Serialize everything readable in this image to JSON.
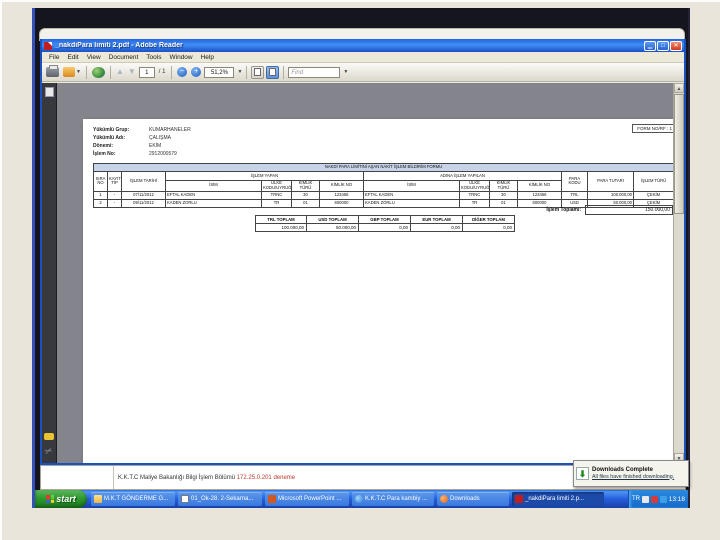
{
  "reader": {
    "title": "_nakdiPara limiti 2.pdf - Adobe Reader",
    "menus": [
      "File",
      "Edit",
      "View",
      "Document",
      "Tools",
      "Window",
      "Help"
    ],
    "toolbar": {
      "page_current": "1",
      "page_total": "/ 1",
      "zoom_out": "−",
      "zoom_in": "+",
      "zoom_level": "51,2%",
      "find_placeholder": "Find",
      "prev_glyph": "▲",
      "next_glyph": "▼"
    },
    "winbtns": {
      "minimize": "▁",
      "maximize": "□",
      "close": "✕"
    },
    "scrollbar": {
      "up": "▲",
      "down": "▼"
    }
  },
  "doc": {
    "form_no": "FORM NO/RF : 1",
    "meta": [
      {
        "label": "Yükümlü Grup:",
        "value": "KUMARHANELER"
      },
      {
        "label": "Yükümlü Adı:",
        "value": "ÇALIŞMA"
      },
      {
        "label": "Dönemi:",
        "value": "EKİM"
      },
      {
        "label": "İşlem No:",
        "value": "2912000579"
      }
    ],
    "table": {
      "title": "NAKDİ PARA LİMİTİNİ AŞAN NAKİT İŞLEM BİLDİRİM FORMU",
      "headers": {
        "sira_no": "SIRA NO",
        "kayit_tip": "KAYIT TİP",
        "islem_tarihi": "İŞLEM TARİHİ",
        "group1": "İŞLEM YAPAN",
        "group2": "ADINA İŞLEM YAPILAN",
        "isim": "İSİM",
        "ulke": "ÜLKE KODU/UYRUĞU",
        "kimlik_turu": "KİMLİK TÜRÜ",
        "kimlik_no": "KİMLİK NO",
        "para_kodu": "PARA KODU",
        "para_tutari": "PARA TUTARI",
        "islem_turu": "İŞLEM TÜRÜ"
      },
      "rows": [
        [
          "1",
          "-",
          "07/11/2012",
          "EFTAL KADEN",
          "TRNC",
          "30",
          "123456",
          "EFTAL KADEN",
          "TRNC",
          "30",
          "123456",
          "TRL",
          "100.000,00",
          "ÇEKİM"
        ],
        [
          "2",
          "-",
          "09/11/2012",
          "KADEN ZORLU",
          "TR",
          "01",
          "600000",
          "KADEN ZORLU",
          "TR",
          "01",
          "600000",
          "USD",
          "50.000,00",
          "ÇEKİM"
        ]
      ],
      "total_label": "İşlem Toplamı:",
      "total_value": "150.000,00"
    },
    "totals": [
      {
        "label": "TRL TOPLAM",
        "value": "100.000,00"
      },
      {
        "label": "USD TOPLAM",
        "value": "50.000,00"
      },
      {
        "label": "GBP TOPLAM",
        "value": "0,00"
      },
      {
        "label": "EUR TOPLAM",
        "value": "0,00"
      },
      {
        "label": "DİĞER TOPLAM",
        "value": "0,00"
      }
    ]
  },
  "statusbar": {
    "text": "K.K.T.C Maliye Bakanlığı Bilgi İşlem Bölümü",
    "ip": "172.25.0.201",
    "note": "deneme"
  },
  "popup": {
    "icon_glyph": "⬇",
    "title": "Downloads Complete",
    "link": "All files have finished downloading."
  },
  "taskbar": {
    "start": "start",
    "tasks": [
      {
        "label": "M.K.T GÖNDERME G..."
      },
      {
        "label": "01_Ok-28. 2-Sekarna..."
      },
      {
        "label": "Microsoft PowerPoint ..."
      },
      {
        "label": "K.K.T.C Para kambiy ..."
      },
      {
        "label": "Downloads"
      },
      {
        "label": "_nakdiPara limiti 2.p..."
      }
    ],
    "tray": {
      "lang": "TR",
      "clock": "13:18"
    }
  },
  "colors": {
    "taskbar_blue": "#245edb",
    "title_blue": "#2665e0",
    "table_title_bg": "#c7d3e8",
    "status_red": "#c0392b"
  }
}
